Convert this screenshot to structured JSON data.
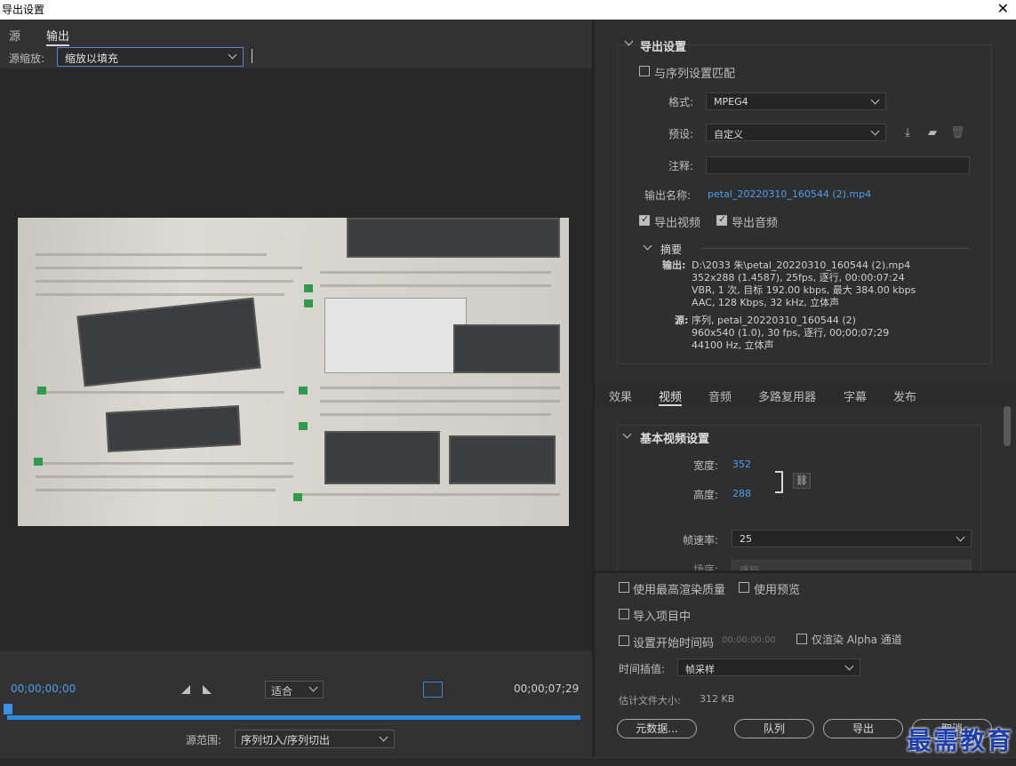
{
  "window": {
    "title": "导出设置",
    "close_glyph": "✕"
  },
  "left": {
    "tabs": [
      "源",
      "输出"
    ],
    "active_tab": "输出",
    "scale_label": "源缩放:",
    "scale_value": "缩放以填充",
    "timecode_start": "00;00;00;00",
    "timecode_end": "00;00;07;29",
    "fit_value": "适合",
    "range_label": "源范围:",
    "range_value": "序列切入/序列切出"
  },
  "export_settings": {
    "header": "导出设置",
    "match_sequence": "与序列设置匹配",
    "format_label": "格式:",
    "format_value": "MPEG4",
    "preset_label": "预设:",
    "preset_value": "自定义",
    "comment_label": "注释:",
    "comment_value": "",
    "output_name_label": "输出名称:",
    "output_name_value": "petal_20220310_160544 (2).mp4",
    "export_video": "导出视频",
    "export_audio": "导出音频",
    "summary_header": "摘要",
    "output_label": "输出:",
    "output_lines": [
      "D:\\2033 朱\\petal_20220310_160544 (2).mp4",
      "352x288 (1.4587), 25fps, 逐行, 00:00:07:24",
      "VBR, 1 次, 目标 192.00 kbps, 最大 384.00 kbps",
      "AAC, 128 Kbps, 32 kHz, 立体声"
    ],
    "source_label": "源:",
    "source_lines": [
      "序列, petal_20220310_160544 (2)",
      "960x540 (1.0), 30 fps, 逐行, 00;00;07;29",
      "44100 Hz, 立体声"
    ]
  },
  "tabs": [
    "效果",
    "视频",
    "音频",
    "多路复用器",
    "字幕",
    "发布"
  ],
  "active_tab": "视频",
  "basic_video": {
    "header": "基本视频设置",
    "width_label": "宽度:",
    "width_value": "352",
    "height_label": "高度:",
    "height_value": "288",
    "framerate_label": "帧速率:",
    "framerate_value": "25",
    "field_label": "场序:",
    "field_value": "逐行"
  },
  "bottom": {
    "max_quality": "使用最高渲染质量",
    "use_preview": "使用预览",
    "import_project": "导入项目中",
    "set_start_tc": "设置开始时间码",
    "start_tc_value": "00:00:00:00",
    "alpha_only": "仅渲染 Alpha 通道",
    "interp_label": "时间插值:",
    "interp_value": "帧采样",
    "filesize_label": "估计文件大小:",
    "filesize_value": "312 KB",
    "metadata_btn": "元数据...",
    "queue_btn": "队列",
    "export_btn": "导出",
    "cancel_btn": "取消"
  },
  "watermark": "最需教育"
}
